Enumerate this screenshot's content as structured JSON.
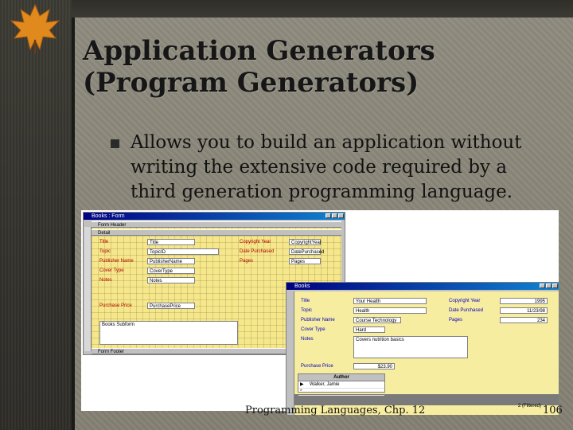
{
  "slide": {
    "title_line1": "Application Generators",
    "title_line2": "(Program Generators)",
    "bullet": "Allows you to build an application without writing the extensive code required by a third generation programming language.",
    "footer": "Programming Languages, Chp. 12",
    "page_number": "106"
  },
  "design_window": {
    "title": "Books : Form",
    "sections": [
      "Form Header",
      "Detail",
      "Form Footer"
    ],
    "fields": [
      {
        "label": "Title",
        "value": "Title"
      },
      {
        "label": "Topic",
        "value": "TopicID"
      },
      {
        "label": "Publisher Name",
        "value": "PublisherName"
      },
      {
        "label": "Cover Type",
        "value": "CoverType"
      },
      {
        "label": "Notes",
        "value": "Notes"
      },
      {
        "label": "Purchase Price",
        "value": "PurchasePrice"
      }
    ],
    "right_fields": [
      {
        "label": "Copyright Year",
        "value": "CopyrightYear"
      },
      {
        "label": "Date Purchased",
        "value": "DatePurchased"
      },
      {
        "label": "Pages",
        "value": "Pages"
      }
    ],
    "subform": "Books Subform"
  },
  "form_window": {
    "title": "Books",
    "fields": [
      {
        "label": "Title",
        "value": "Your Health"
      },
      {
        "label": "Topic",
        "value": "Health"
      },
      {
        "label": "Publisher Name",
        "value": "Course Technology"
      },
      {
        "label": "Cover Type",
        "value": "Hard"
      },
      {
        "label": "Notes",
        "value": "Covers nutrition basics"
      },
      {
        "label": "Purchase Price",
        "value": "$23.90"
      }
    ],
    "right_fields": [
      {
        "label": "Copyright Year",
        "value": "1995"
      },
      {
        "label": "Date Purchased",
        "value": "11/23/98"
      },
      {
        "label": "Pages",
        "value": "234"
      }
    ],
    "author_header": "Author",
    "author_value": "Walker, Jamie",
    "record_status": "2 (Filtered)"
  }
}
